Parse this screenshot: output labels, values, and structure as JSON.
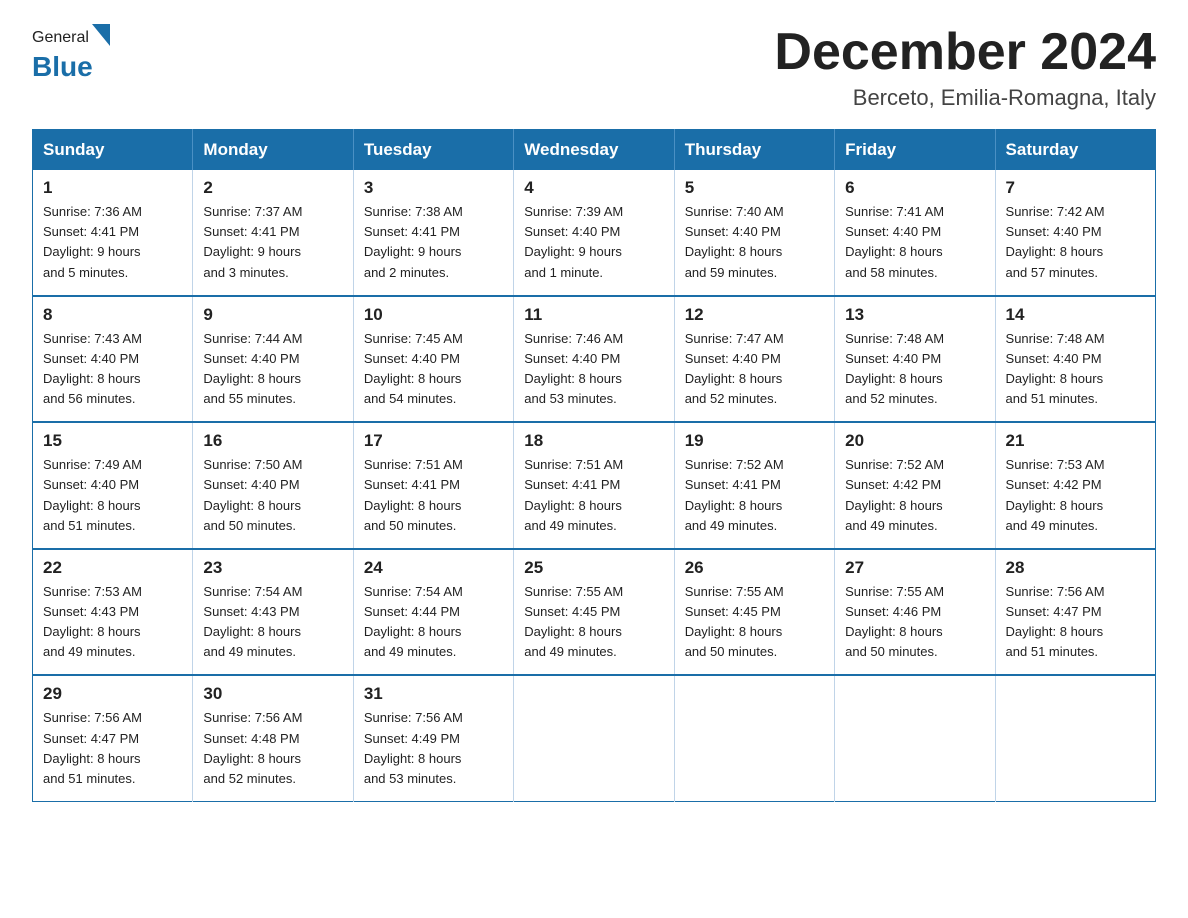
{
  "header": {
    "logo_general": "General",
    "logo_blue": "Blue",
    "month_title": "December 2024",
    "location": "Berceto, Emilia-Romagna, Italy"
  },
  "days_of_week": [
    "Sunday",
    "Monday",
    "Tuesday",
    "Wednesday",
    "Thursday",
    "Friday",
    "Saturday"
  ],
  "weeks": [
    [
      {
        "day": "1",
        "sunrise": "7:36 AM",
        "sunset": "4:41 PM",
        "daylight_hours": "9 hours",
        "daylight_minutes": "and 5 minutes."
      },
      {
        "day": "2",
        "sunrise": "7:37 AM",
        "sunset": "4:41 PM",
        "daylight_hours": "9 hours",
        "daylight_minutes": "and 3 minutes."
      },
      {
        "day": "3",
        "sunrise": "7:38 AM",
        "sunset": "4:41 PM",
        "daylight_hours": "9 hours",
        "daylight_minutes": "and 2 minutes."
      },
      {
        "day": "4",
        "sunrise": "7:39 AM",
        "sunset": "4:40 PM",
        "daylight_hours": "9 hours",
        "daylight_minutes": "and 1 minute."
      },
      {
        "day": "5",
        "sunrise": "7:40 AM",
        "sunset": "4:40 PM",
        "daylight_hours": "8 hours",
        "daylight_minutes": "and 59 minutes."
      },
      {
        "day": "6",
        "sunrise": "7:41 AM",
        "sunset": "4:40 PM",
        "daylight_hours": "8 hours",
        "daylight_minutes": "and 58 minutes."
      },
      {
        "day": "7",
        "sunrise": "7:42 AM",
        "sunset": "4:40 PM",
        "daylight_hours": "8 hours",
        "daylight_minutes": "and 57 minutes."
      }
    ],
    [
      {
        "day": "8",
        "sunrise": "7:43 AM",
        "sunset": "4:40 PM",
        "daylight_hours": "8 hours",
        "daylight_minutes": "and 56 minutes."
      },
      {
        "day": "9",
        "sunrise": "7:44 AM",
        "sunset": "4:40 PM",
        "daylight_hours": "8 hours",
        "daylight_minutes": "and 55 minutes."
      },
      {
        "day": "10",
        "sunrise": "7:45 AM",
        "sunset": "4:40 PM",
        "daylight_hours": "8 hours",
        "daylight_minutes": "and 54 minutes."
      },
      {
        "day": "11",
        "sunrise": "7:46 AM",
        "sunset": "4:40 PM",
        "daylight_hours": "8 hours",
        "daylight_minutes": "and 53 minutes."
      },
      {
        "day": "12",
        "sunrise": "7:47 AM",
        "sunset": "4:40 PM",
        "daylight_hours": "8 hours",
        "daylight_minutes": "and 52 minutes."
      },
      {
        "day": "13",
        "sunrise": "7:48 AM",
        "sunset": "4:40 PM",
        "daylight_hours": "8 hours",
        "daylight_minutes": "and 52 minutes."
      },
      {
        "day": "14",
        "sunrise": "7:48 AM",
        "sunset": "4:40 PM",
        "daylight_hours": "8 hours",
        "daylight_minutes": "and 51 minutes."
      }
    ],
    [
      {
        "day": "15",
        "sunrise": "7:49 AM",
        "sunset": "4:40 PM",
        "daylight_hours": "8 hours",
        "daylight_minutes": "and 51 minutes."
      },
      {
        "day": "16",
        "sunrise": "7:50 AM",
        "sunset": "4:40 PM",
        "daylight_hours": "8 hours",
        "daylight_minutes": "and 50 minutes."
      },
      {
        "day": "17",
        "sunrise": "7:51 AM",
        "sunset": "4:41 PM",
        "daylight_hours": "8 hours",
        "daylight_minutes": "and 50 minutes."
      },
      {
        "day": "18",
        "sunrise": "7:51 AM",
        "sunset": "4:41 PM",
        "daylight_hours": "8 hours",
        "daylight_minutes": "and 49 minutes."
      },
      {
        "day": "19",
        "sunrise": "7:52 AM",
        "sunset": "4:41 PM",
        "daylight_hours": "8 hours",
        "daylight_minutes": "and 49 minutes."
      },
      {
        "day": "20",
        "sunrise": "7:52 AM",
        "sunset": "4:42 PM",
        "daylight_hours": "8 hours",
        "daylight_minutes": "and 49 minutes."
      },
      {
        "day": "21",
        "sunrise": "7:53 AM",
        "sunset": "4:42 PM",
        "daylight_hours": "8 hours",
        "daylight_minutes": "and 49 minutes."
      }
    ],
    [
      {
        "day": "22",
        "sunrise": "7:53 AM",
        "sunset": "4:43 PM",
        "daylight_hours": "8 hours",
        "daylight_minutes": "and 49 minutes."
      },
      {
        "day": "23",
        "sunrise": "7:54 AM",
        "sunset": "4:43 PM",
        "daylight_hours": "8 hours",
        "daylight_minutes": "and 49 minutes."
      },
      {
        "day": "24",
        "sunrise": "7:54 AM",
        "sunset": "4:44 PM",
        "daylight_hours": "8 hours",
        "daylight_minutes": "and 49 minutes."
      },
      {
        "day": "25",
        "sunrise": "7:55 AM",
        "sunset": "4:45 PM",
        "daylight_hours": "8 hours",
        "daylight_minutes": "and 49 minutes."
      },
      {
        "day": "26",
        "sunrise": "7:55 AM",
        "sunset": "4:45 PM",
        "daylight_hours": "8 hours",
        "daylight_minutes": "and 50 minutes."
      },
      {
        "day": "27",
        "sunrise": "7:55 AM",
        "sunset": "4:46 PM",
        "daylight_hours": "8 hours",
        "daylight_minutes": "and 50 minutes."
      },
      {
        "day": "28",
        "sunrise": "7:56 AM",
        "sunset": "4:47 PM",
        "daylight_hours": "8 hours",
        "daylight_minutes": "and 51 minutes."
      }
    ],
    [
      {
        "day": "29",
        "sunrise": "7:56 AM",
        "sunset": "4:47 PM",
        "daylight_hours": "8 hours",
        "daylight_minutes": "and 51 minutes."
      },
      {
        "day": "30",
        "sunrise": "7:56 AM",
        "sunset": "4:48 PM",
        "daylight_hours": "8 hours",
        "daylight_minutes": "and 52 minutes."
      },
      {
        "day": "31",
        "sunrise": "7:56 AM",
        "sunset": "4:49 PM",
        "daylight_hours": "8 hours",
        "daylight_minutes": "and 53 minutes."
      },
      null,
      null,
      null,
      null
    ]
  ]
}
